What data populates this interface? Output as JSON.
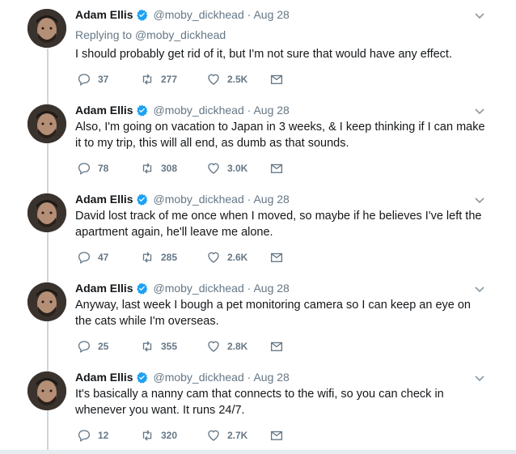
{
  "tweets": [
    {
      "name": "Adam Ellis",
      "handle": "@moby_dickhead",
      "separator": "·",
      "date": "Aug 28",
      "replying_prefix": "Replying to",
      "replying_handle": "@moby_dickhead",
      "text": "I should probably get rid of it, but I'm not sure that would have any effect.",
      "replies": "37",
      "retweets": "277",
      "likes": "2.5K"
    },
    {
      "name": "Adam Ellis",
      "handle": "@moby_dickhead",
      "separator": "·",
      "date": "Aug 28",
      "text": "Also, I'm going on vacation to Japan in 3 weeks, & I keep thinking if I can make it to my trip, this will all end, as dumb as that sounds.",
      "replies": "78",
      "retweets": "308",
      "likes": "3.0K"
    },
    {
      "name": "Adam Ellis",
      "handle": "@moby_dickhead",
      "separator": "·",
      "date": "Aug 28",
      "text": "David lost track of me once when I moved, so maybe if he believes I've left the apartment again, he'll leave me alone.",
      "replies": "47",
      "retweets": "285",
      "likes": "2.6K"
    },
    {
      "name": "Adam Ellis",
      "handle": "@moby_dickhead",
      "separator": "·",
      "date": "Aug 28",
      "text": "Anyway, last week I bough a pet monitoring camera so I can keep an eye on the cats while I'm overseas.",
      "replies": "25",
      "retweets": "355",
      "likes": "2.8K"
    },
    {
      "name": "Adam Ellis",
      "handle": "@moby_dickhead",
      "separator": "·",
      "date": "Aug 28",
      "text": "It's basically a nanny cam that connects to the wifi, so you can check in whenever you want. It runs 24/7.",
      "replies": "12",
      "retweets": "320",
      "likes": "2.7K"
    }
  ],
  "icons": {
    "verified": "verified-badge-icon",
    "caret": "chevron-down-icon",
    "reply": "reply-icon",
    "retweet": "retweet-icon",
    "like": "heart-icon",
    "dm": "envelope-icon"
  },
  "colors": {
    "verified": "#1da1f2",
    "secondary_text": "#657786",
    "primary_text": "#14171a",
    "thread_line": "#ccd6dd"
  }
}
